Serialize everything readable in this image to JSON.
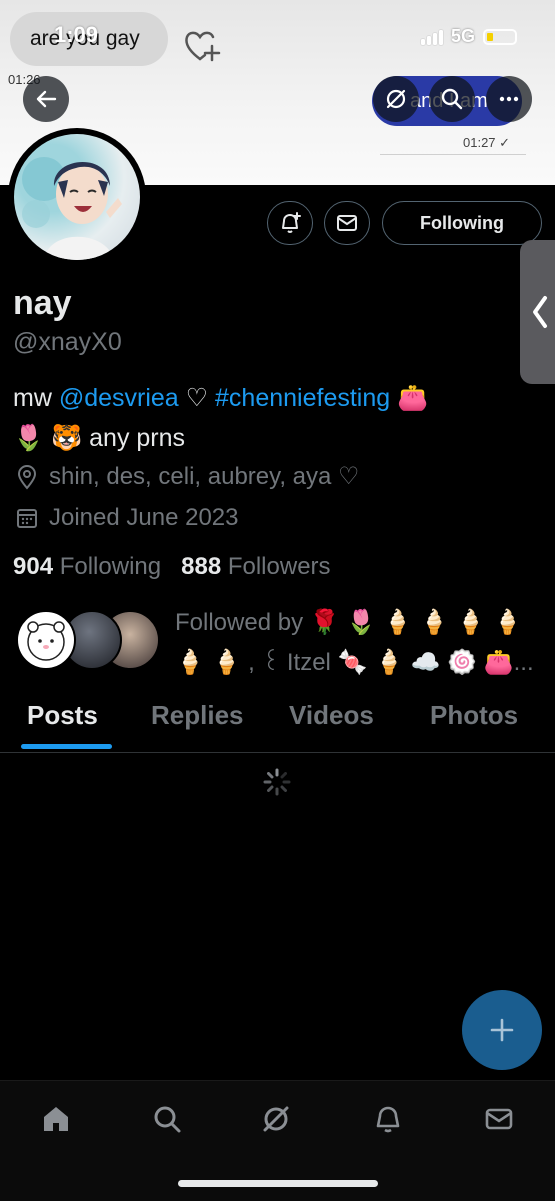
{
  "status_bar": {
    "time": "1:09",
    "network": "5G",
    "battery_color": "#f4d000"
  },
  "banner": {
    "left_message": "are you gay",
    "left_time": "01:26",
    "right_message": "and I am",
    "right_time": "01:27 ✓",
    "outgoing_bubble_color": "#2a3aa6"
  },
  "profile": {
    "name": "nay",
    "handle": "@xnayX0",
    "bio_prefix": "mw ",
    "bio_mention": "@desvriea",
    "bio_mid": " ♡ ",
    "bio_hashtag": "#chenniefesting",
    "bio_emoji": " 👛",
    "bio_line2": "🌷 🐯 any prns",
    "location": "shin, des, celi, aubrey, aya ♡",
    "joined": "Joined June 2023",
    "following_count": "904",
    "following_label": "Following",
    "followers_count": "888",
    "followers_label": "Followers",
    "followed_by": "Followed by 🌹 🌷 🍦 🍦 🍦 🍦 🍦 🍦 , ꒰ Itzel 🍬 🍦 ☁️ 🍥 👛..."
  },
  "actions": {
    "following_button": "Following"
  },
  "tabs": [
    {
      "label": "Posts",
      "active": true
    },
    {
      "label": "Replies",
      "active": false
    },
    {
      "label": "Videos",
      "active": false
    },
    {
      "label": "Photos",
      "active": false
    }
  ],
  "icons": {
    "back": "back-arrow-icon",
    "grok": "grok-icon",
    "search": "search-icon",
    "more": "more-icon",
    "notify": "notification-plus-icon",
    "message": "mail-icon",
    "compose": "plus-icon"
  },
  "colors": {
    "accent": "#1d9bf0",
    "fab": "#1a5d8f",
    "secondary_text": "#71767b"
  }
}
